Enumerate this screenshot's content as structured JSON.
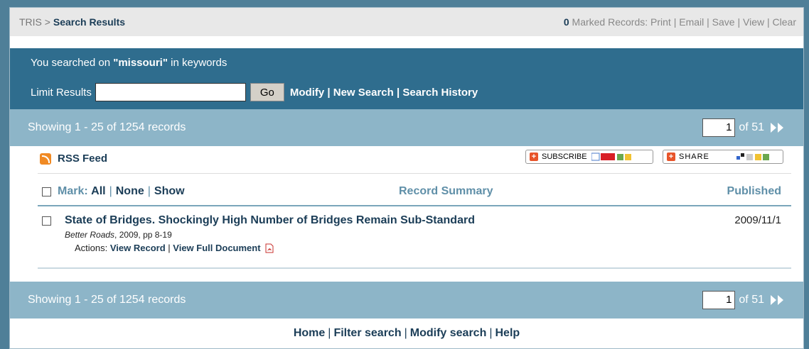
{
  "breadcrumb": {
    "root": "TRIS",
    "separator": ">",
    "current": "Search Results"
  },
  "marked": {
    "count": "0",
    "label": "Marked Records:",
    "actions": [
      "Print",
      "Email",
      "Save",
      "View",
      "Clear"
    ]
  },
  "search": {
    "prefix": "You searched on",
    "term": "\"missouri\"",
    "suffix": "in keywords",
    "limit_label": "Limit Results",
    "limit_value": "",
    "go_label": "Go",
    "links": [
      "Modify",
      "New Search",
      "Search History"
    ]
  },
  "results_bar": {
    "showing": "Showing 1 - 25 of 1254 records",
    "page": "1",
    "of_pages": "of 51",
    "next_icon": "double-chevron-right"
  },
  "feed": {
    "rss_label": "RSS Feed",
    "subscribe_label": "SUBSCRIBE",
    "share_label": "SHARE"
  },
  "table": {
    "mark_label": "Mark:",
    "mark_options": [
      "All",
      "None",
      "Show"
    ],
    "summary_header": "Record Summary",
    "published_header": "Published"
  },
  "records": [
    {
      "title": "State of Bridges. Shockingly High Number of Bridges Remain Sub-Standard",
      "source_journal": "Better Roads",
      "source_details": ", 2009, pp 8-19",
      "published": "2009/11/1",
      "actions_label": "Actions:",
      "actions": [
        "View Record",
        "View Full Document"
      ]
    }
  ],
  "footer": {
    "links": [
      "Home",
      "Filter search",
      "Modify search",
      "Help"
    ]
  },
  "colors": {
    "band": "#2f6d8e",
    "bar": "#8db5c8",
    "link": "#1b3d57",
    "outer": "#4f7f98"
  }
}
